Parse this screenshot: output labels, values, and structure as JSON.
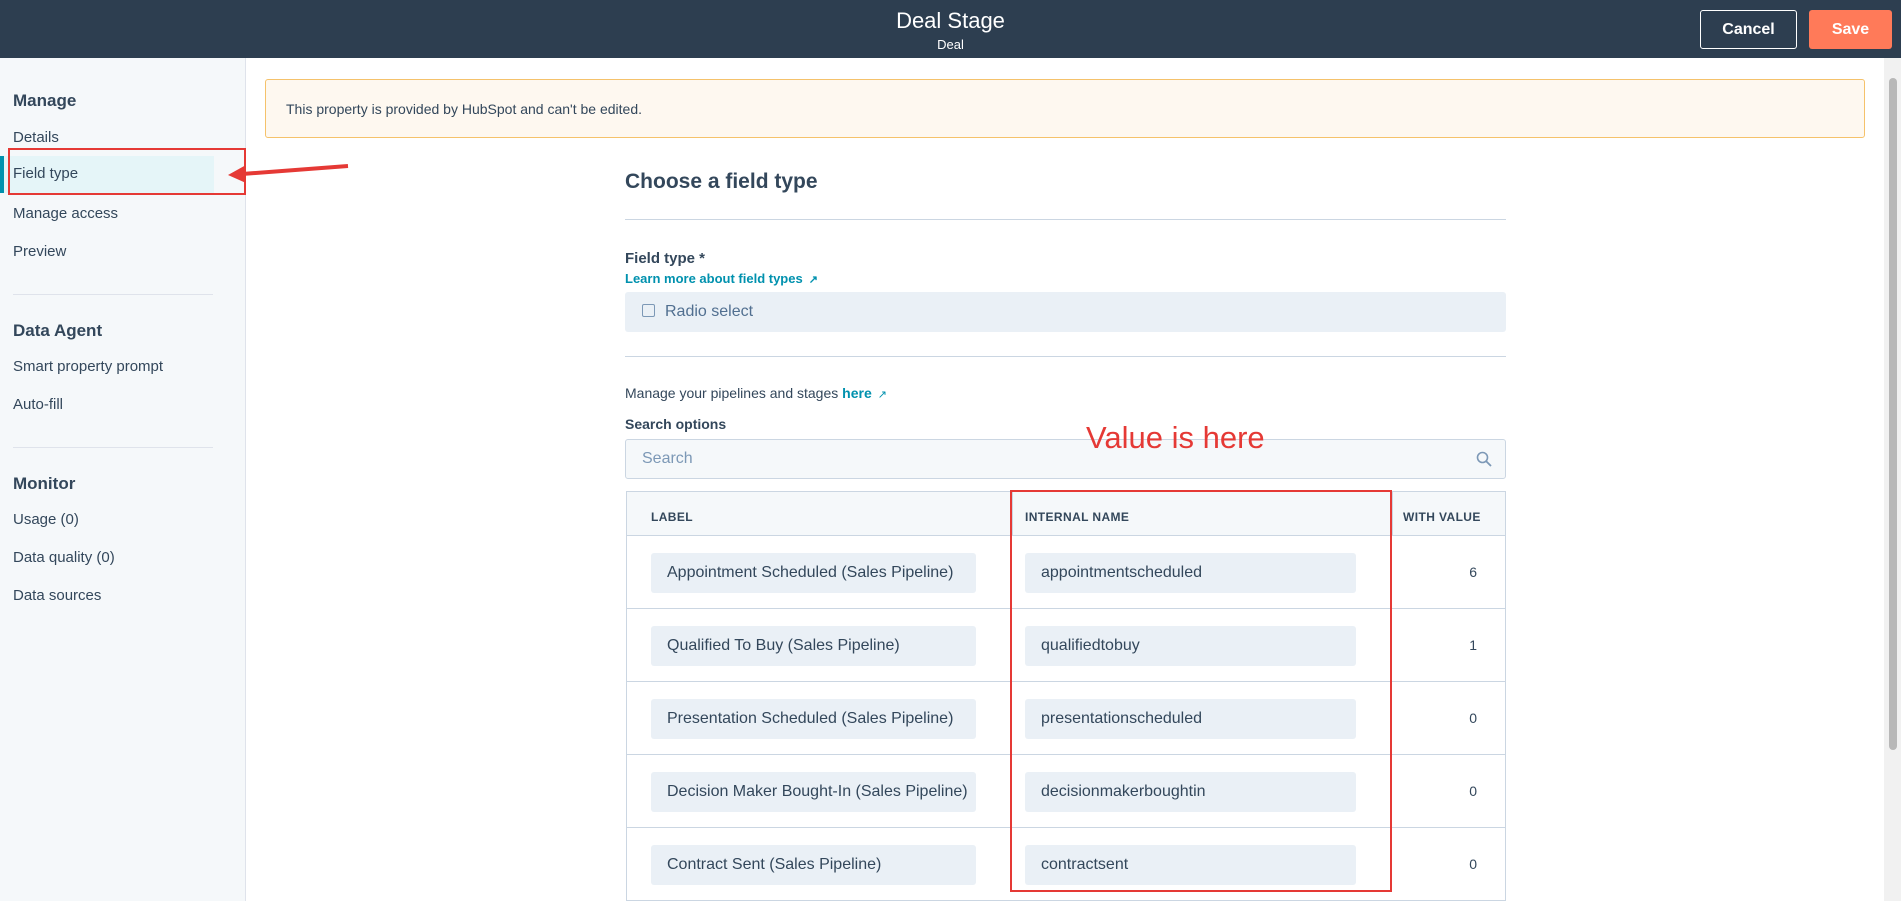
{
  "header": {
    "title": "Deal Stage",
    "subtitle": "Deal",
    "cancel_label": "Cancel",
    "save_label": "Save"
  },
  "sidebar": {
    "manage_heading": "Manage",
    "manage_items": [
      "Details",
      "Field type",
      "Manage access",
      "Preview"
    ],
    "active_item": "Field type",
    "data_agent_heading": "Data Agent",
    "data_agent_items": [
      "Smart property prompt",
      "Auto-fill"
    ],
    "monitor_heading": "Monitor",
    "monitor_items": [
      "Usage (0)",
      "Data quality (0)",
      "Data sources"
    ]
  },
  "notice": {
    "text": "This property is provided by HubSpot and can't be edited."
  },
  "main": {
    "section_title": "Choose a field type",
    "field_type_label": "Field type *",
    "learn_more_link": "Learn more about field types",
    "field_type_value": "Radio select",
    "pipelines_text": "Manage your pipelines and stages",
    "pipelines_link": "here",
    "search_label": "Search options",
    "search_placeholder": "Search"
  },
  "annotation": {
    "text": "Value is here",
    "color": "#e53935"
  },
  "table": {
    "headers": [
      "LABEL",
      "INTERNAL NAME",
      "WITH VALUE"
    ],
    "rows": [
      {
        "label": "Appointment Scheduled (Sales Pipeline)",
        "internal": "appointmentscheduled",
        "count": "6"
      },
      {
        "label": "Qualified To Buy (Sales Pipeline)",
        "internal": "qualifiedtobuy",
        "count": "1"
      },
      {
        "label": "Presentation Scheduled (Sales Pipeline)",
        "internal": "presentationscheduled",
        "count": "0"
      },
      {
        "label": "Decision Maker Bought-In (Sales Pipeline)",
        "internal": "decisionmakerboughtin",
        "count": "0"
      },
      {
        "label": "Contract Sent (Sales Pipeline)",
        "internal": "contractsent",
        "count": "0"
      }
    ]
  },
  "colors": {
    "header_bg": "#2d3e50",
    "accent": "#ff7a59",
    "link": "#0091ae"
  }
}
